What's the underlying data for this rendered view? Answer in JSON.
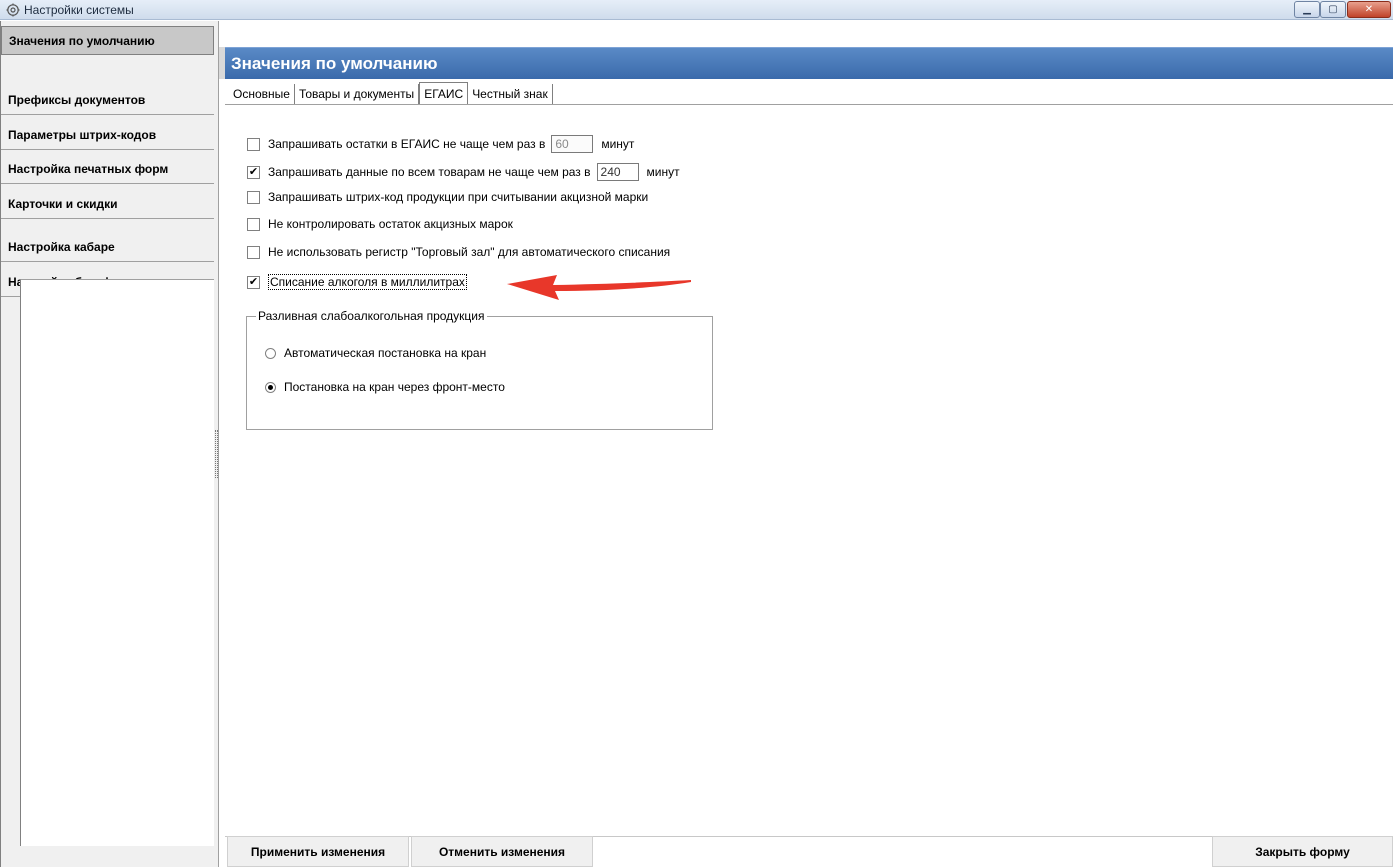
{
  "window": {
    "title": "Настройки системы",
    "icon": "gear-icon",
    "controls": {
      "minimize": "minimize-icon",
      "maximize": "maximize-icon",
      "close": "close-icon"
    }
  },
  "sidebar": {
    "items": [
      {
        "label": "Значения по умолчанию",
        "active": true
      },
      {
        "label": "Префиксы документов",
        "active": false
      },
      {
        "label": "Параметры штрих-кодов",
        "active": false
      },
      {
        "label": "Настройка печатных форм",
        "active": false
      },
      {
        "label": "Карточки и скидки",
        "active": false
      },
      {
        "label": "Настройка кабаре",
        "active": false
      },
      {
        "label": "Настройки бэкофиса",
        "active": false
      }
    ]
  },
  "header": {
    "title": "Значения по умолчанию",
    "color": "#3a6aab"
  },
  "tabs": [
    {
      "label": "Основные",
      "active": false
    },
    {
      "label": "Товары и документы",
      "active": false
    },
    {
      "label": "ЕГАИС",
      "active": true
    },
    {
      "label": "Честный знак",
      "active": false
    }
  ],
  "options": {
    "opt1": {
      "text": "Запрашивать остатки в ЕГАИС не чаще чем раз в",
      "checked": false,
      "value": "60",
      "suffix": "минут"
    },
    "opt2": {
      "text": "Запрашивать данные по всем товарам не чаще чем раз в",
      "checked": true,
      "value": "240",
      "suffix": "минут"
    },
    "opt3": {
      "text": "Запрашивать штрих-код продукции при считывании акцизной марки",
      "checked": false
    },
    "opt4": {
      "text": "Не контролировать остаток акцизных марок",
      "checked": false
    },
    "opt5": {
      "text": "Не использовать регистр \"Торговый зал\" для автоматического списания",
      "checked": false
    },
    "opt6": {
      "text": "Списание алкоголя в миллилитрах",
      "checked": true
    }
  },
  "annotation": {
    "arrow_color": "#e8372a",
    "points_to": "opt6"
  },
  "group": {
    "legend": "Разливная слабоалкогольная продукция",
    "radios": [
      {
        "label": "Автоматическая постановка на кран",
        "selected": false
      },
      {
        "label": "Постановка на кран через фронт-место",
        "selected": true
      }
    ]
  },
  "footer": {
    "apply": "Применить изменения",
    "cancel": "Отменить изменения",
    "close": "Закрыть форму"
  },
  "glyphs": {
    "check": "✔"
  }
}
